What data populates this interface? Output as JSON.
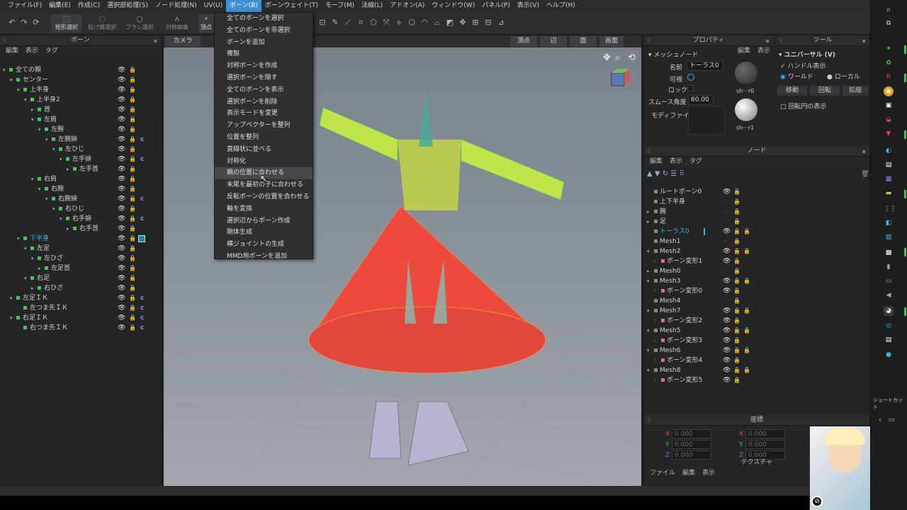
{
  "menubar": {
    "items": [
      "ファイル(F)",
      "編集(E)",
      "作成(C)",
      "選択部処理(S)",
      "ノード処理(N)",
      "UV(U)",
      "ボーン(B)",
      "ボーンウェイト(T)",
      "モーフ(M)",
      "法線(L)",
      "アドオン(A)",
      "ウィンドウ(W)",
      "パネル(P)",
      "表示(V)",
      "ヘルプ(H)"
    ],
    "active_index": 6
  },
  "toolbar": {
    "select_modes": [
      "矩形選択",
      "投げ縄選択",
      "ブラシ選択",
      "対称編集",
      "頂点"
    ]
  },
  "bone_menu": {
    "items": [
      "全てのボーンを選択",
      "全てのボーンを非選択",
      "ボーンを追加",
      "複製",
      "対称ボーンを作成",
      "選択ボーンを隠す",
      "全てのボーンを表示",
      "選択ボーンを削除",
      "表示モードを変更",
      "アップベクターを整列",
      "位置を整列",
      "直線状に並べる",
      "対称化",
      "親の位置に合わせる",
      "末尾を最初の子に合わせる",
      "反転ボーンの位置を合わせる",
      "軸を変換",
      "選択辺からボーン作成",
      "剛体生成",
      "横ジョイントの生成",
      "MMD用ボーンを追加"
    ],
    "hover_index": 13
  },
  "bone_panel": {
    "title": "ボーン",
    "tabs": [
      "編集",
      "表示",
      "タグ"
    ],
    "tree": [
      {
        "label": "全ての親",
        "indent": 0,
        "arrow": "▾",
        "c": false
      },
      {
        "label": "センター",
        "indent": 1,
        "arrow": "▾",
        "c": false
      },
      {
        "label": "上半身",
        "indent": 2,
        "arrow": "▾",
        "c": false
      },
      {
        "label": "上半身2",
        "indent": 3,
        "arrow": "▾",
        "c": false
      },
      {
        "label": "首",
        "indent": 4,
        "arrow": "▸",
        "c": false
      },
      {
        "label": "左肩",
        "indent": 4,
        "arrow": "▾",
        "c": false
      },
      {
        "label": "左腕",
        "indent": 5,
        "arrow": "▾",
        "c": false
      },
      {
        "label": "左腕捩",
        "indent": 6,
        "arrow": "▾",
        "c": true
      },
      {
        "label": "左ひじ",
        "indent": 7,
        "arrow": "▾",
        "c": false
      },
      {
        "label": "左手捩",
        "indent": 8,
        "arrow": "▾",
        "c": true
      },
      {
        "label": "左手首",
        "indent": 9,
        "arrow": "▸",
        "c": false
      },
      {
        "label": "右肩",
        "indent": 4,
        "arrow": "▾",
        "c": false
      },
      {
        "label": "右腕",
        "indent": 5,
        "arrow": "▾",
        "c": false
      },
      {
        "label": "右腕捩",
        "indent": 6,
        "arrow": "▾",
        "c": true
      },
      {
        "label": "右ひじ",
        "indent": 7,
        "arrow": "▾",
        "c": false
      },
      {
        "label": "右手捩",
        "indent": 8,
        "arrow": "▾",
        "c": true
      },
      {
        "label": "右手首",
        "indent": 9,
        "arrow": "▸",
        "c": false
      },
      {
        "label": "下半身",
        "indent": 2,
        "arrow": "▾",
        "c": false,
        "highlight": true
      },
      {
        "label": "左足",
        "indent": 3,
        "arrow": "▾",
        "c": false
      },
      {
        "label": "左ひざ",
        "indent": 4,
        "arrow": "▾",
        "c": false
      },
      {
        "label": "左足首",
        "indent": 5,
        "arrow": "▸",
        "c": false
      },
      {
        "label": "右足",
        "indent": 3,
        "arrow": "▾",
        "c": false
      },
      {
        "label": "右ひざ",
        "indent": 4,
        "arrow": "▸",
        "c": false
      },
      {
        "label": "左足ＩＫ",
        "indent": 1,
        "arrow": "▾",
        "c": true
      },
      {
        "label": "左つま先ＩＫ",
        "indent": 2,
        "arrow": "",
        "c": true
      },
      {
        "label": "右足ＩＫ",
        "indent": 1,
        "arrow": "▾",
        "c": true
      },
      {
        "label": "右つま先ＩＫ",
        "indent": 2,
        "arrow": "",
        "c": true
      }
    ]
  },
  "viewport": {
    "tabs_left": [
      "カメラ"
    ],
    "tabs_right": [
      "頂点",
      "辺",
      "面",
      "画面"
    ]
  },
  "property_panel": {
    "title": "プロパティ",
    "section": "メッシュノード",
    "name_label": "名前",
    "name_value": "トーラス0",
    "visible_label": "可視",
    "lock_label": "ロック",
    "smooth_label": "スムース角度",
    "smooth_value": "60.00",
    "modifier_label": "モディファイア",
    "material_tabs": [
      "編集",
      "表示"
    ],
    "materials": [
      "sh···r0",
      "sh···r1"
    ]
  },
  "tool_panel": {
    "title": "ツール",
    "section": "ユニバーサル (V)",
    "handle_label": "ハンドル表示",
    "world_label": "ワールド",
    "local_label": "ローカル",
    "buttons": [
      "移動",
      "回転",
      "拡縮"
    ],
    "rotation_circle_label": "回転円の表示"
  },
  "node_panel": {
    "title": "ノード",
    "tabs": [
      "編集",
      "表示",
      "タグ"
    ],
    "items": [
      {
        "label": "ルートボーン0",
        "indent": 0,
        "arrow": "",
        "eye": true,
        "lockr": false
      },
      {
        "label": "上下半身",
        "indent": 0,
        "arrow": "",
        "eye": false,
        "lockr": false
      },
      {
        "label": "腕",
        "indent": 0,
        "arrow": "▸",
        "eye": false,
        "lockr": false
      },
      {
        "label": "足",
        "indent": 0,
        "arrow": "▸",
        "eye": false,
        "lockr": false
      },
      {
        "label": "トーラス0",
        "indent": 0,
        "arrow": "",
        "eye": true,
        "lockr": true,
        "selected": true
      },
      {
        "label": "Mesh1",
        "indent": 0,
        "arrow": "",
        "eye": false,
        "lockr": false
      },
      {
        "label": "Mesh2",
        "indent": 0,
        "arrow": "▾",
        "eye": true,
        "lockr": true
      },
      {
        "label": "ボーン変形1",
        "indent": 1,
        "arrow": "",
        "eye": true,
        "lockr": false
      },
      {
        "label": "Mesh0",
        "indent": 0,
        "arrow": "▸",
        "eye": false,
        "lockr": false
      },
      {
        "label": "Mesh3",
        "indent": 0,
        "arrow": "▾",
        "eye": true,
        "lockr": true
      },
      {
        "label": "ボーン変形0",
        "indent": 1,
        "arrow": "",
        "eye": true,
        "lockr": false
      },
      {
        "label": "Mesh4",
        "indent": 0,
        "arrow": "",
        "eye": false,
        "lockr": false
      },
      {
        "label": "Mesh7",
        "indent": 0,
        "arrow": "▾",
        "eye": true,
        "lockr": true
      },
      {
        "label": "ボーン変形2",
        "indent": 1,
        "arrow": "",
        "eye": true,
        "lockr": false
      },
      {
        "label": "Mesh5",
        "indent": 0,
        "arrow": "▾",
        "eye": true,
        "lockr": true
      },
      {
        "label": "ボーン変形3",
        "indent": 1,
        "arrow": "",
        "eye": true,
        "lockr": false
      },
      {
        "label": "Mesh6",
        "indent": 0,
        "arrow": "▾",
        "eye": true,
        "lockr": true
      },
      {
        "label": "ボーン変形4",
        "indent": 1,
        "arrow": "",
        "eye": true,
        "lockr": false
      },
      {
        "label": "Mesh8",
        "indent": 0,
        "arrow": "▾",
        "eye": true,
        "lockr": true
      },
      {
        "label": "ボーン変形5",
        "indent": 1,
        "arrow": "",
        "eye": true,
        "lockr": false
      }
    ]
  },
  "coord_panel": {
    "title": "座標",
    "labels": [
      "X",
      "Y",
      "Z"
    ],
    "values": [
      "0.000",
      "0.000",
      "0.000"
    ]
  },
  "texture_panel": {
    "title": "テクスチャ",
    "tabs": [
      "ファイル",
      "編集",
      "表示"
    ]
  },
  "taskbar": {
    "shortcut_label": "ショートカット"
  }
}
